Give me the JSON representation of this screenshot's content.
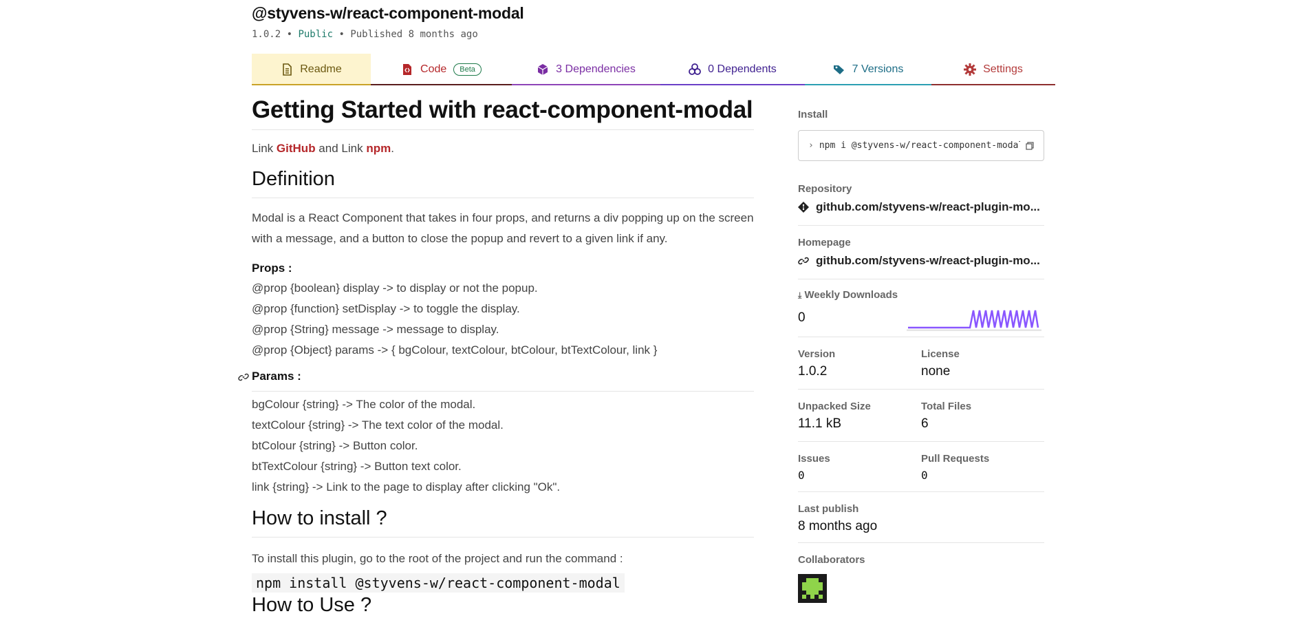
{
  "package": {
    "name": "@styvens-w/react-component-modal",
    "version": "1.0.2",
    "visibility": "Public",
    "published": "Published 8 months ago"
  },
  "tabs": [
    {
      "label": "Readme",
      "icon": "document-icon"
    },
    {
      "label": "Code",
      "icon": "file-code-icon",
      "badge": "Beta"
    },
    {
      "label": "3 Dependencies",
      "icon": "box-icon"
    },
    {
      "label": "0 Dependents",
      "icon": "boxes-icon"
    },
    {
      "label": "7 Versions",
      "icon": "tags-icon"
    },
    {
      "label": "Settings",
      "icon": "gear-icon"
    }
  ],
  "readme": {
    "title": "Getting Started with react-component-modal",
    "links_line": {
      "prefix": "Link ",
      "github": "GitHub",
      "middle": " and Link ",
      "npm": "npm",
      "suffix": "."
    },
    "definition_heading": "Definition",
    "definition_text": "Modal is a React Component that takes in four props, and returns a div popping up on the screen with a message, and a button to close the popup and revert to a given link if any.",
    "props_heading": "Props :",
    "props": [
      "@prop {boolean} display -> to display or not the popup.",
      "@prop {function} setDisplay -> to toggle the display.",
      "@prop {String} message -> message to display.",
      "@prop {Object} params -> { bgColour, textColour, btColour, btTextColour, link }"
    ],
    "params_heading": "Params :",
    "params": [
      "bgColour {string} -> The color of the modal.",
      "textColour {string} -> The text color of the modal.",
      "btColour {string} -> Button color.",
      "btTextColour {string} -> Button text color.",
      "link {string} -> Link to the page to display after clicking \"Ok\"."
    ],
    "install_heading": "How to install ?",
    "install_text": "To install this plugin, go to the root of the project and run the command :",
    "install_code": "npm install @styvens-w/react-component-modal",
    "use_heading": "How to Use ?"
  },
  "sidebar": {
    "install_label": "Install",
    "install_cmd": "npm i @styvens-w/react-component-modal",
    "repository_label": "Repository",
    "repository": "github.com/styvens-w/react-plugin-mo...",
    "homepage_label": "Homepage",
    "homepage": "github.com/styvens-w/react-plugin-mo...",
    "weekly_label": "Weekly Downloads",
    "weekly_value": "0",
    "sparkline_color": "#8956ff",
    "version_label": "Version",
    "version": "1.0.2",
    "license_label": "License",
    "license": "none",
    "unpacked_label": "Unpacked Size",
    "unpacked": "11.1 kB",
    "files_label": "Total Files",
    "files": "6",
    "issues_label": "Issues",
    "issues": "0",
    "prs_label": "Pull Requests",
    "prs": "0",
    "last_publish_label": "Last publish",
    "last_publish": "8 months ago",
    "collaborators_label": "Collaborators"
  }
}
